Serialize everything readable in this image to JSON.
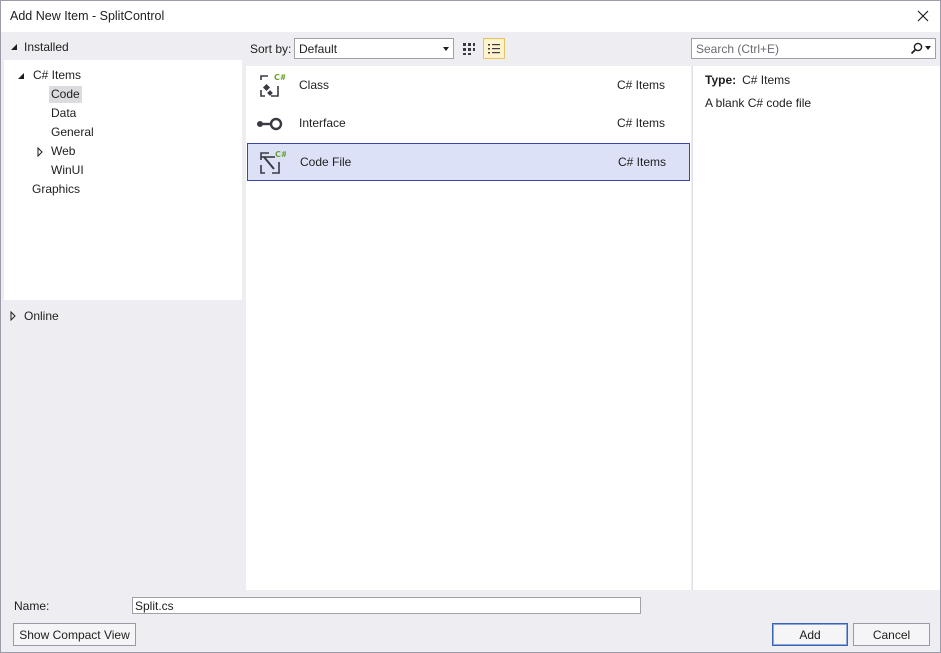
{
  "window": {
    "title": "Add New Item - SplitControl"
  },
  "left": {
    "installed_label": "Installed",
    "tree": [
      {
        "label": "C# Items"
      },
      {
        "label": "Code"
      },
      {
        "label": "Data"
      },
      {
        "label": "General"
      },
      {
        "label": "Web"
      },
      {
        "label": "WinUI"
      },
      {
        "label": "Graphics"
      }
    ],
    "online_label": "Online"
  },
  "toolbar": {
    "sort_label": "Sort by:",
    "sort_value": "Default"
  },
  "search": {
    "placeholder": "Search (Ctrl+E)"
  },
  "items": [
    {
      "name": "Class",
      "category": "C# Items",
      "icon": "class-icon"
    },
    {
      "name": "Interface",
      "category": "C# Items",
      "icon": "interface-icon"
    },
    {
      "name": "Code File",
      "category": "C# Items",
      "icon": "code-file-icon"
    }
  ],
  "details": {
    "type_label": "Type:",
    "type_value": "C# Items",
    "description": "A blank C# code file"
  },
  "bottom": {
    "name_label": "Name:",
    "name_value": "Split.cs",
    "compact_view_button": "Show Compact View",
    "add_button": "Add",
    "cancel_button": "Cancel"
  },
  "colors": {
    "selected_item_bg": "#dde1f8",
    "selected_item_border": "#3b46a8",
    "csharp_badge": "#68a12f"
  }
}
